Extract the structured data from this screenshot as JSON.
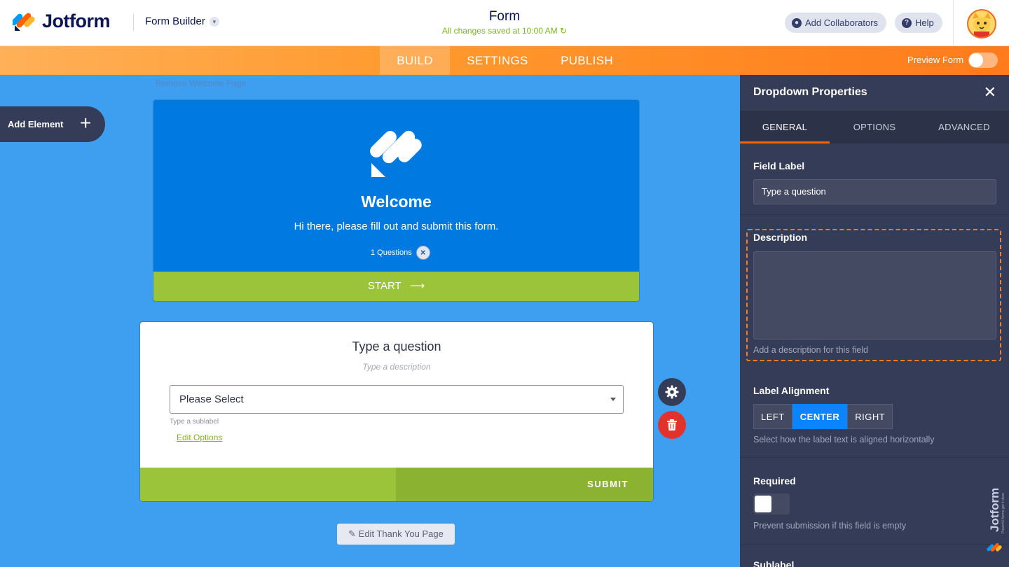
{
  "header": {
    "brand": "Jotform",
    "builder_label": "Form Builder",
    "form_title": "Form",
    "save_status": "All changes saved at 10:00 AM",
    "add_collaborators": "Add Collaborators",
    "help": "Help"
  },
  "nav": {
    "tabs": [
      "BUILD",
      "SETTINGS",
      "PUBLISH"
    ],
    "active_tab": "BUILD",
    "preview_label": "Preview Form",
    "preview_on": false
  },
  "canvas": {
    "remove_welcome": "Remove Welcome Page",
    "add_element": "Add Element",
    "welcome": {
      "title": "Welcome",
      "subtitle": "Hi there, please fill out and submit this form.",
      "questions_count": "1 Questions",
      "start": "START"
    },
    "question": {
      "label": "Type a question",
      "description_placeholder": "Type a description",
      "select_value": "Please Select",
      "sublabel_placeholder": "Type a sublabel",
      "edit_options": "Edit Options",
      "submit": "SUBMIT"
    },
    "edit_thank_you": "Edit Thank You Page"
  },
  "panel": {
    "title": "Dropdown Properties",
    "tabs": [
      "GENERAL",
      "OPTIONS",
      "ADVANCED"
    ],
    "active_tab": "GENERAL",
    "field_label": {
      "label": "Field Label",
      "value": "Type a question"
    },
    "description": {
      "label": "Description",
      "value": "",
      "hint": "Add a description for this field"
    },
    "label_alignment": {
      "label": "Label Alignment",
      "options": [
        "LEFT",
        "CENTER",
        "RIGHT"
      ],
      "selected": "CENTER",
      "hint": "Select how the label text is aligned horizontally"
    },
    "required": {
      "label": "Required",
      "value": false,
      "hint": "Prevent submission if this field is empty"
    },
    "sublabel": {
      "label": "Sublabel"
    }
  },
  "watermark": {
    "brand": "Jotform",
    "tagline": "Powerful forms get it done"
  },
  "colors": {
    "brand_orange": "#ff6100",
    "canvas_blue": "#3e9ef0",
    "panel_navy": "#343c57",
    "accent_green": "#9cc43b",
    "accent_blue": "#0a84ff",
    "danger_red": "#e3322c"
  }
}
